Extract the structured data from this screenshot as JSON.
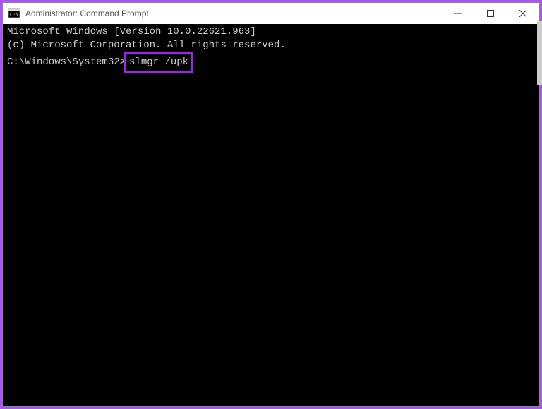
{
  "titlebar": {
    "title": "Administrator: Command Prompt"
  },
  "terminal": {
    "line1": "Microsoft Windows [Version 10.0.22621.963]",
    "line2": "(c) Microsoft Corporation. All rights reserved.",
    "blank": "",
    "prompt": "C:\\Windows\\System32>",
    "command": "slmgr /upk"
  }
}
